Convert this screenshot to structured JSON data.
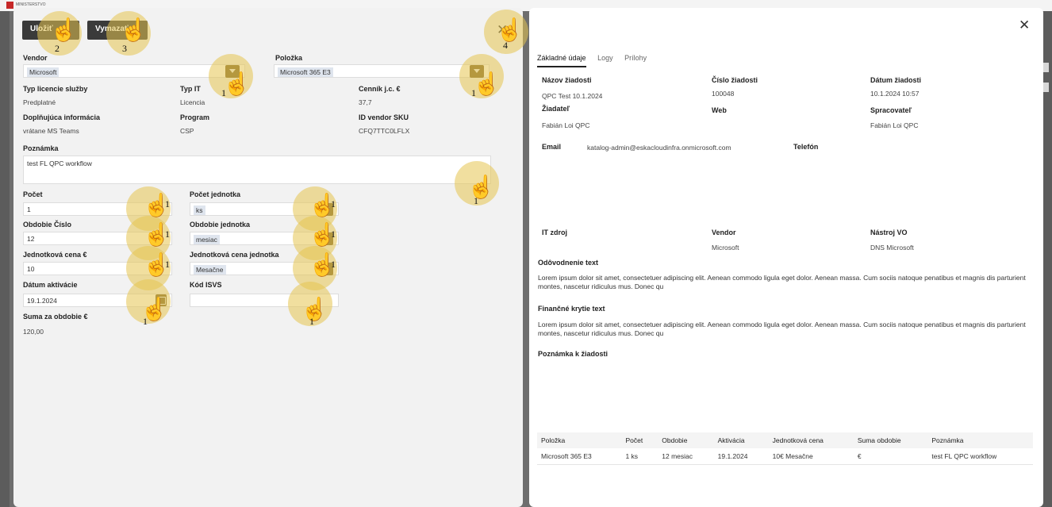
{
  "app": {
    "logo_text": "MINISTERSTVO"
  },
  "left": {
    "save_label": "Uložiť",
    "delete_label": "Vymazať",
    "close_glyph": "✕",
    "fields": {
      "vendor": {
        "label": "Vendor",
        "value": "Microsoft"
      },
      "polozka": {
        "label": "Položka",
        "value": "Microsoft 365 E3"
      },
      "typ_licencie": {
        "label": "Typ licencie služby",
        "value": "Predplatné"
      },
      "typ_it": {
        "label": "Typ IT",
        "value": "Licencia"
      },
      "cennik": {
        "label": "Cenník j.c. €",
        "value": "37,7"
      },
      "doplnujuca": {
        "label": "Doplňujúca informácia",
        "value": "vrátane MS Teams"
      },
      "program": {
        "label": "Program",
        "value": "CSP"
      },
      "id_vendor_sku": {
        "label": "ID vendor SKU",
        "value": "CFQ7TTC0LFLX"
      },
      "poznamka": {
        "label": "Poznámka",
        "value": "test FL QPC workflow"
      },
      "pocet": {
        "label": "Počet",
        "value": "1"
      },
      "pocet_jednotka": {
        "label": "Počet jednotka",
        "value": "ks"
      },
      "obdobie_cislo": {
        "label": "Obdobie Číslo",
        "value": "12"
      },
      "obdobie_jednotka": {
        "label": "Obdobie jednotka",
        "value": "mesiac"
      },
      "jednotkova_cena": {
        "label": "Jednotková cena €",
        "value": "10"
      },
      "jednotkova_cena_jednotka": {
        "label": "Jednotková cena jednotka",
        "value": "Mesačne"
      },
      "datum_aktivacie": {
        "label": "Dátum aktivácie",
        "value": "19.1.2024"
      },
      "kod_isvs": {
        "label": "Kód ISVS",
        "value": ""
      },
      "suma": {
        "label": "Suma za obdobie €",
        "value": "120,00"
      }
    }
  },
  "annotations": {
    "n1": "1",
    "n2": "2",
    "n3": "3",
    "n4": "4",
    "hand_glyph": "☝"
  },
  "right": {
    "close_glyph": "✕",
    "tabs": [
      "Základné údaje",
      "Logy",
      "Prílohy"
    ],
    "nazov": {
      "label": "Názov žiadosti",
      "value": "QPC Test 10.1.2024"
    },
    "cislo": {
      "label": "Číslo žiadosti",
      "value": "100048"
    },
    "datum": {
      "label": "Dátum žiadosti",
      "value": "10.1.2024 10:57"
    },
    "ziadatel": {
      "label": "Žiadateľ",
      "value": "Fabián Loi QPC"
    },
    "web": {
      "label": "Web",
      "value": ""
    },
    "spracovatel": {
      "label": "Spracovateľ",
      "value": "Fabián Loi QPC"
    },
    "email": {
      "label": "Email",
      "value": "katalog-admin@eskacloudinfra.onmicrosoft.com"
    },
    "telefon": {
      "label": "Telefón",
      "value": ""
    },
    "it_zdroj": {
      "label": "IT zdroj",
      "value": ""
    },
    "vendor": {
      "label": "Vendor",
      "value": "Microsoft"
    },
    "nastroj": {
      "label": "Nástroj VO",
      "value": "DNS Microsoft"
    },
    "odovodnenie": {
      "label": "Odôvodnenie text",
      "value": "Lorem ipsum dolor sit amet, consectetuer adipiscing elit. Aenean commodo ligula eget dolor. Aenean massa. Cum sociis natoque penatibus et magnis dis parturient montes, nascetur ridiculus mus. Donec qu"
    },
    "financne": {
      "label": "Finančné krytie text",
      "value": "Lorem ipsum dolor sit amet, consectetuer adipiscing elit. Aenean commodo ligula eget dolor. Aenean massa. Cum sociis natoque penatibus et magnis dis parturient montes, nascetur ridiculus mus. Donec qu"
    },
    "poznamka_k_ziadosti": {
      "label": "Poznámka k žiadosti",
      "value": ""
    },
    "table": {
      "headers": [
        "Položka",
        "Počet",
        "Obdobie",
        "Aktivácia",
        "Jednotková cena",
        "Suma obdobie",
        "Poznámka"
      ],
      "rows": [
        [
          "Microsoft 365 E3",
          "1 ks",
          "12 mesiac",
          "19.1.2024",
          "10€ Mesačne",
          "€",
          "test FL QPC workflow"
        ]
      ]
    }
  }
}
